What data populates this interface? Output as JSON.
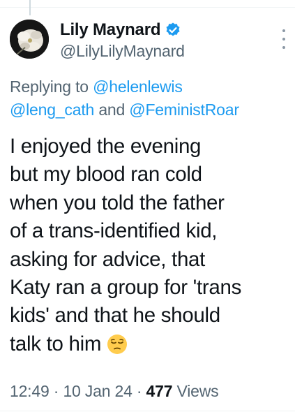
{
  "tweet": {
    "display_name": "Lily Maynard",
    "handle": "@LilyLilyMaynard",
    "reply_prefix": "Replying to",
    "mention_1": "@helenlewis",
    "mention_2": "@leng_cath",
    "reply_and": "and",
    "mention_3": "@FeministRoar",
    "text": "I enjoyed the evening\nbut my blood ran cold\nwhen you told the father\nof a trans-identified kid,\nasking for advice, that\nKaty ran a group for 'trans\nkids' and that he should\ntalk to him",
    "time": "12:49",
    "separator": "·",
    "date": "10 Jan 24",
    "views_count": "477",
    "views_label": "Views"
  },
  "icons": {
    "verified": "verified-badge-icon",
    "more": "more-options-icon",
    "emoji": "pensive-face-emoji"
  },
  "colors": {
    "link": "#1d9bf0",
    "secondary": "#536471",
    "primary": "#0f1419"
  }
}
